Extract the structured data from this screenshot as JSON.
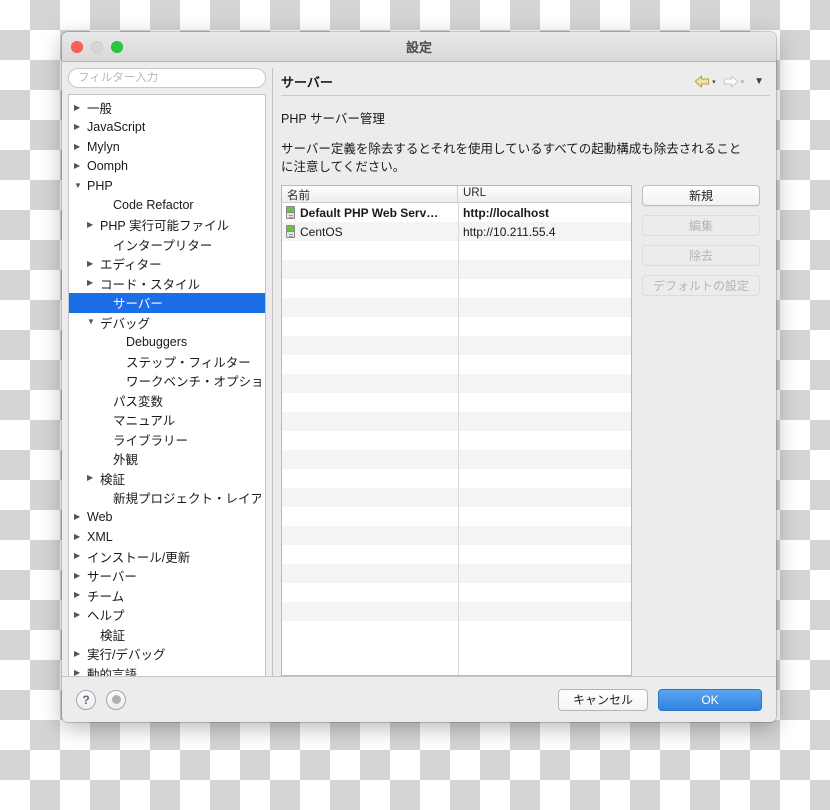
{
  "window": {
    "title": "設定",
    "traffic_lights": [
      "close-red",
      "minimize-disabled",
      "zoom-green"
    ]
  },
  "sidebar": {
    "filter": {
      "value": "",
      "placeholder": "フィルター入力"
    },
    "items": [
      {
        "label": "一般",
        "indent": 0,
        "twisty": "collapsed",
        "selected": false
      },
      {
        "label": "JavaScript",
        "indent": 0,
        "twisty": "collapsed",
        "selected": false
      },
      {
        "label": "Mylyn",
        "indent": 0,
        "twisty": "collapsed",
        "selected": false
      },
      {
        "label": "Oomph",
        "indent": 0,
        "twisty": "collapsed",
        "selected": false
      },
      {
        "label": "PHP",
        "indent": 0,
        "twisty": "expanded",
        "selected": false
      },
      {
        "label": "Code Refactor",
        "indent": 2,
        "twisty": "none",
        "selected": false
      },
      {
        "label": "PHP 実行可能ファイル",
        "indent": 1,
        "twisty": "collapsed",
        "selected": false
      },
      {
        "label": "インタープリター",
        "indent": 2,
        "twisty": "none",
        "selected": false
      },
      {
        "label": "エディター",
        "indent": 1,
        "twisty": "collapsed",
        "selected": false
      },
      {
        "label": "コード・スタイル",
        "indent": 1,
        "twisty": "collapsed",
        "selected": false
      },
      {
        "label": "サーバー",
        "indent": 2,
        "twisty": "none",
        "selected": true
      },
      {
        "label": "デバッグ",
        "indent": 1,
        "twisty": "expanded",
        "selected": false
      },
      {
        "label": "Debuggers",
        "indent": 3,
        "twisty": "none",
        "selected": false
      },
      {
        "label": "ステップ・フィルター",
        "indent": 3,
        "twisty": "none",
        "selected": false
      },
      {
        "label": "ワークベンチ・オプショ…",
        "indent": 3,
        "twisty": "none",
        "selected": false
      },
      {
        "label": "パス変数",
        "indent": 2,
        "twisty": "none",
        "selected": false
      },
      {
        "label": "マニュアル",
        "indent": 2,
        "twisty": "none",
        "selected": false
      },
      {
        "label": "ライブラリー",
        "indent": 2,
        "twisty": "none",
        "selected": false
      },
      {
        "label": "外観",
        "indent": 2,
        "twisty": "none",
        "selected": false
      },
      {
        "label": "検証",
        "indent": 1,
        "twisty": "collapsed",
        "selected": false
      },
      {
        "label": "新規プロジェクト・レイア",
        "indent": 2,
        "twisty": "none",
        "selected": false
      },
      {
        "label": "Web",
        "indent": 0,
        "twisty": "collapsed",
        "selected": false
      },
      {
        "label": "XML",
        "indent": 0,
        "twisty": "collapsed",
        "selected": false
      },
      {
        "label": "インストール/更新",
        "indent": 0,
        "twisty": "collapsed",
        "selected": false
      },
      {
        "label": "サーバー",
        "indent": 0,
        "twisty": "collapsed",
        "selected": false
      },
      {
        "label": "チーム",
        "indent": 0,
        "twisty": "collapsed",
        "selected": false
      },
      {
        "label": "ヘルプ",
        "indent": 0,
        "twisty": "collapsed",
        "selected": false
      },
      {
        "label": "検証",
        "indent": 1,
        "twisty": "none",
        "selected": false
      },
      {
        "label": "実行/デバッグ",
        "indent": 0,
        "twisty": "collapsed",
        "selected": false
      },
      {
        "label": "動的言語",
        "indent": 0,
        "twisty": "collapsed",
        "selected": false
      }
    ]
  },
  "page": {
    "title": "サーバー",
    "nav": {
      "back_icon": "back-arrow-icon",
      "back_caret": "▾",
      "forward_icon": "forward-arrow-icon",
      "forward_caret": "▾",
      "menu_caret": "▼"
    },
    "section_title": "PHP サーバー管理",
    "description": "サーバー定義を除去するとそれを使用しているすべての起動構成も除去されることに注意してください。"
  },
  "table": {
    "columns": [
      "名前",
      "URL"
    ],
    "rows": [
      {
        "icon": "server-icon",
        "name": "Default PHP Web Serv…",
        "url": "http://localhost",
        "bold": true
      },
      {
        "icon": "server-icon",
        "name": "CentOS",
        "url": "http://10.211.55.4",
        "bold": false
      }
    ],
    "empty_row_count": 20
  },
  "side_buttons": [
    {
      "label": "新規",
      "enabled": true
    },
    {
      "label": "編集",
      "enabled": false
    },
    {
      "label": "除去",
      "enabled": false
    },
    {
      "label": "デフォルトの設定",
      "enabled": false
    }
  ],
  "footer": {
    "help_label": "?",
    "options_icon": "options-dot-icon",
    "cancel_label": "キャンセル",
    "ok_label": "OK"
  },
  "colors": {
    "selection_blue": "#1c6ee8",
    "primary_button_blue": "#2f82e0",
    "server_icon_green": "#6fbf4f",
    "back_arrow_gold": "#e8d9a0"
  }
}
